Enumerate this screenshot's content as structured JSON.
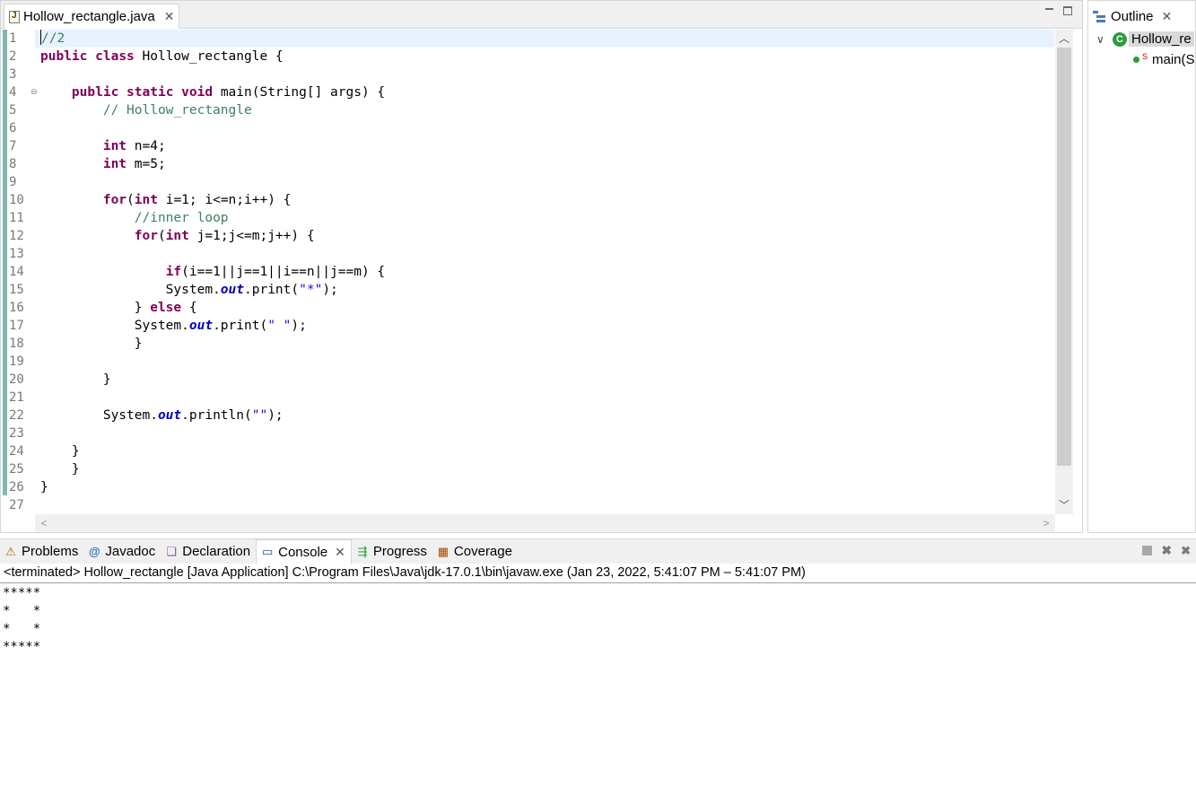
{
  "editor": {
    "tab_label": "Hollow_rectangle.java",
    "line_numbers": [
      "1",
      "2",
      "3",
      "4",
      "5",
      "6",
      "7",
      "8",
      "9",
      "10",
      "11",
      "12",
      "13",
      "14",
      "15",
      "16",
      "17",
      "18",
      "19",
      "20",
      "21",
      "22",
      "23",
      "24",
      "25",
      "26",
      "27"
    ],
    "code_lines": [
      "//2",
      "public class Hollow_rectangle {",
      "",
      "    public static void main(String[] args) {",
      "        // Hollow_rectangle",
      "",
      "        int n=4;",
      "        int m=5;",
      "",
      "        for(int i=1; i<=n;i++) {",
      "            //inner loop",
      "            for(int j=1;j<=m;j++) {",
      "",
      "                if(i==1||j==1||i==n||j==m) {",
      "                System.out.print(\"*\");",
      "            } else {",
      "            System.out.print(\" \");",
      "            }",
      "",
      "        }",
      "",
      "        System.out.println(\"\");",
      "",
      "    }",
      "    }",
      "}",
      ""
    ]
  },
  "outline": {
    "tab_label": "Outline",
    "class_name": "Hollow_re",
    "method_name": "main(S"
  },
  "console": {
    "tabs": [
      {
        "label": "Problems",
        "icon": "problems-icon"
      },
      {
        "label": "Javadoc",
        "icon": "javadoc-icon"
      },
      {
        "label": "Declaration",
        "icon": "declaration-icon"
      },
      {
        "label": "Console",
        "icon": "console-icon",
        "active": true
      },
      {
        "label": "Progress",
        "icon": "progress-icon"
      },
      {
        "label": "Coverage",
        "icon": "coverage-icon"
      }
    ],
    "description": "<terminated> Hollow_rectangle [Java Application] C:\\Program Files\\Java\\jdk-17.0.1\\bin\\javaw.exe  (Jan 23, 2022, 5:41:07 PM – 5:41:07 PM)",
    "output_lines": [
      "*****",
      "*   *",
      "*   *",
      "*****"
    ]
  }
}
